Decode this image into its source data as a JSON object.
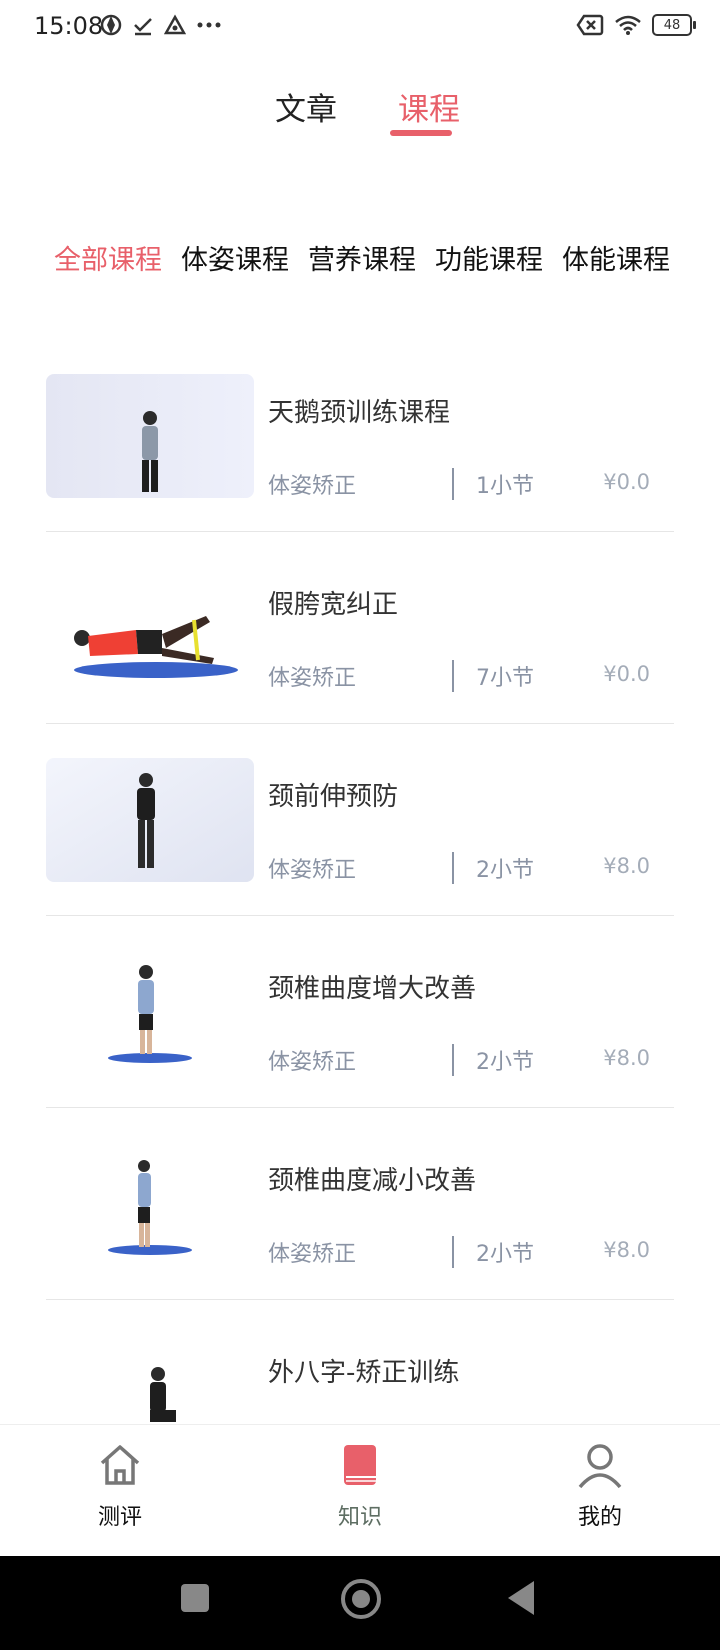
{
  "status_bar": {
    "time": "15:08",
    "battery": "48"
  },
  "top_tabs": [
    {
      "label": "文章",
      "active": false
    },
    {
      "label": "课程",
      "active": true
    }
  ],
  "category_tabs": [
    {
      "label": "全部课程",
      "active": true
    },
    {
      "label": "体姿课程",
      "active": false
    },
    {
      "label": "营养课程",
      "active": false
    },
    {
      "label": "功能课程",
      "active": false
    },
    {
      "label": "体能课程",
      "active": false
    }
  ],
  "courses": [
    {
      "title": "天鹅颈训练课程",
      "category": "体姿矫正",
      "lessons": "1小节",
      "price": "¥0.0"
    },
    {
      "title": "假胯宽纠正",
      "category": "体姿矫正",
      "lessons": "7小节",
      "price": "¥0.0"
    },
    {
      "title": "颈前伸预防",
      "category": "体姿矫正",
      "lessons": "2小节",
      "price": "¥8.0"
    },
    {
      "title": "颈椎曲度增大改善",
      "category": "体姿矫正",
      "lessons": "2小节",
      "price": "¥8.0"
    },
    {
      "title": "颈椎曲度减小改善",
      "category": "体姿矫正",
      "lessons": "2小节",
      "price": "¥8.0"
    },
    {
      "title": "外八字-矫正训练",
      "category": "",
      "lessons": "",
      "price": ""
    }
  ],
  "bottom_nav": [
    {
      "label": "测评",
      "icon": "home-icon",
      "active": false
    },
    {
      "label": "知识",
      "icon": "book-icon",
      "active": true
    },
    {
      "label": "我的",
      "icon": "user-icon",
      "active": false
    }
  ],
  "colors": {
    "accent": "#e8606a",
    "muted": "#8a93a4"
  }
}
